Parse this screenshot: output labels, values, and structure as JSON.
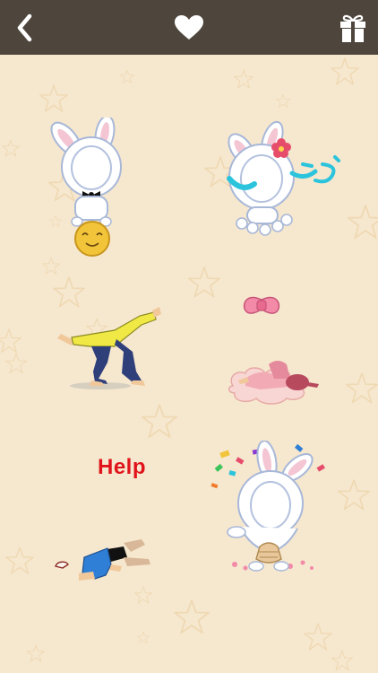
{
  "toolbar": {
    "back_icon": "chevron-left-icon",
    "favorite_icon": "heart-icon",
    "gift_icon": "gift-icon"
  },
  "colors": {
    "toolbar": "#4e463d",
    "background": "#f6e7cf",
    "icon": "#ffffff",
    "star_outline": "#efd9b2",
    "help_text": "#e0141a"
  },
  "stickers": [
    {
      "id": "bunny-on-ball"
    },
    {
      "id": "bunny-with-flower"
    },
    {
      "id": "bending-man"
    },
    {
      "id": "girl-on-cloud"
    },
    {
      "id": "fallen-man",
      "caption": "Help"
    },
    {
      "id": "bunny-celebrating"
    }
  ]
}
